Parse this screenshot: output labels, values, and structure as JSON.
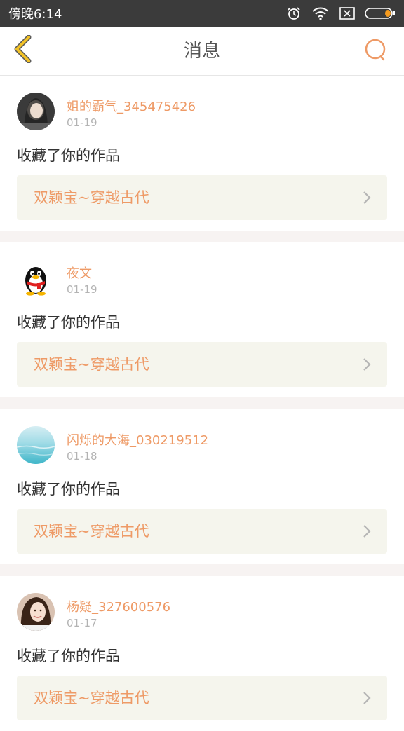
{
  "status_bar": {
    "time": "傍晚6:14",
    "icons": [
      "alarm-icon",
      "wifi-icon",
      "sim-icon",
      "battery-icon"
    ]
  },
  "header": {
    "title": "消息",
    "back_icon": "chevron-left-icon",
    "search_icon": "search-icon"
  },
  "colors": {
    "accent": "#ee9a66",
    "back_arrow": "#f2c227",
    "status_bar_bg": "#3b3b3b",
    "card_link_bg": "#f5f5ed",
    "separator": "#f7f3f2"
  },
  "messages": [
    {
      "username": "姐的霸气_345475426",
      "date": "01-19",
      "action": "收藏了你的作品",
      "work_title": "双颖宝~穿越古代",
      "avatar": "photo-avatar-woman"
    },
    {
      "username": "夜文",
      "date": "01-19",
      "action": "收藏了你的作品",
      "work_title": "双颖宝~穿越古代",
      "avatar": "penguin-avatar"
    },
    {
      "username": "闪烁的大海_030219512",
      "date": "01-18",
      "action": "收藏了你的作品",
      "work_title": "双颖宝~穿越古代",
      "avatar": "sea-avatar"
    },
    {
      "username": "杨疑_327600576",
      "date": "01-17",
      "action": "收藏了你的作品",
      "work_title": "双颖宝~穿越古代",
      "avatar": "photo-avatar-woman"
    }
  ]
}
